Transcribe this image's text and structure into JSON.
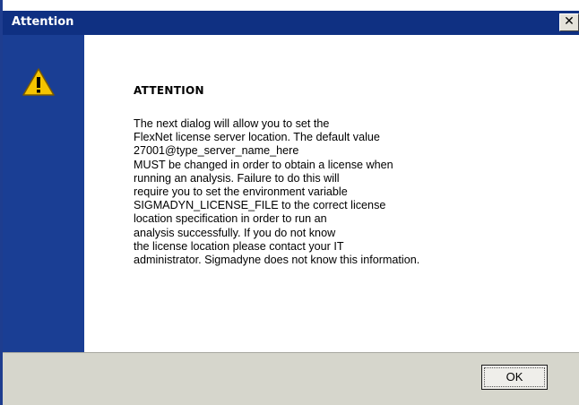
{
  "window": {
    "title": "Attention",
    "close_label": "✕"
  },
  "side_panel": {
    "icon": "warning-icon"
  },
  "content": {
    "heading": "ATTENTION",
    "message_lines": [
      "The next dialog will allow you to set the",
      "FlexNet license server location. The default value",
      "27001@type_server_name_here",
      "MUST be changed in order to obtain a license when",
      "running an analysis. Failure to do this will",
      "require you to set the environment variable",
      "SIGMADYN_LICENSE_FILE to the correct license",
      "location specification in order to run an",
      "analysis successfully. If you do not know",
      "the license location please contact your IT",
      "administrator. Sigmadyne does not know this information."
    ]
  },
  "footer": {
    "ok_label": "OK"
  },
  "colors": {
    "titlebar": "#0f3082",
    "side_panel": "#1a3e94",
    "footer": "#d6d6cc",
    "warning_yellow": "#f5c400"
  }
}
